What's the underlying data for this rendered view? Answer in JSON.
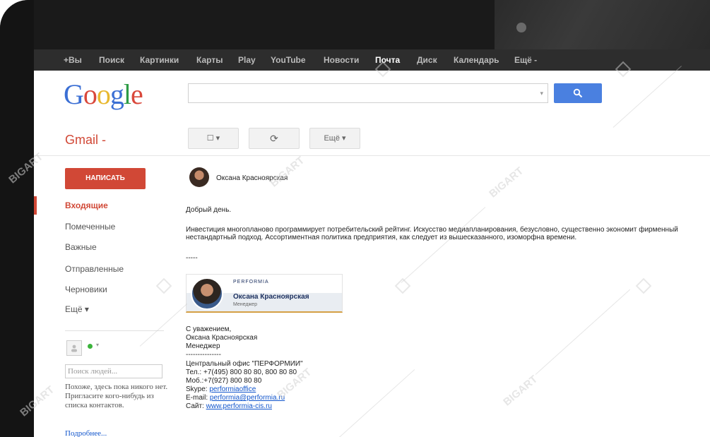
{
  "topbar": {
    "items": [
      "+Вы",
      "Поиск",
      "Картинки",
      "Карты",
      "Play",
      "YouTube",
      "Новости",
      "Почта",
      "Диск",
      "Календарь",
      "Ещё -"
    ]
  },
  "brand": {
    "logo_letters": [
      "G",
      "o",
      "o",
      "g",
      "l",
      "e"
    ]
  },
  "search": {
    "placeholder": "",
    "arrow": "▾",
    "button_icon": "search-icon"
  },
  "gmail": {
    "label": "Gmail -"
  },
  "toolbar": {
    "select_label": "☐ ▾",
    "refresh_icon": "⟳",
    "more_label": "Ещё ▾"
  },
  "sidebar": {
    "compose_label": "НАПИСАТЬ",
    "folders": [
      "Входящие",
      "Помеченные",
      "Важные",
      "Отправленные",
      "Черновики",
      "Ещё ▾"
    ]
  },
  "chat": {
    "status_arrow": "▾",
    "search_placeholder": "Поиск людей...",
    "message": "Похоже, здесь пока никого нет. Пригласите кого-нибудь из списка контактов.",
    "more_link": "Подробнее..."
  },
  "email": {
    "sender_name": "Оксана Красноярская",
    "greeting": "Добрый день.",
    "body": "Инвестиция многопланово программирует потребительский рейтинг. Искусство медиапланирования, безусловно, существенно экономит фирменный нестандартный подход. Ассортиментная политика предприятия, как следует из вышесказанного, изоморфна времени.",
    "separator": "-----",
    "signature_card": {
      "brand": "PERFORMIA",
      "name": "Оксана Красноярская",
      "role": "Менеджер"
    },
    "closing": "С уважением,",
    "closing_name": "Оксана Красноярская",
    "closing_role": "Менеджер",
    "dashes": "---------------",
    "office": "Центральный офис \"ПЕРФОРМИИ\"",
    "phone": "Тел.: +7(495) 800 80 80, 800 80 80",
    "mobile": "Моб.:+7(927) 800 80 80",
    "skype_label": "Skype: ",
    "skype": "performiaoffice",
    "email_label": "E-mail: ",
    "email": "performia@performia.ru",
    "site_label": "Сайт: ",
    "site": "www.performia-cis.ru"
  },
  "watermark": {
    "text": "BIGART"
  },
  "colors": {
    "compose": "#d14836",
    "search_button": "#4a80e0",
    "topbar": "#2d2d2d",
    "link": "#1155cc"
  }
}
